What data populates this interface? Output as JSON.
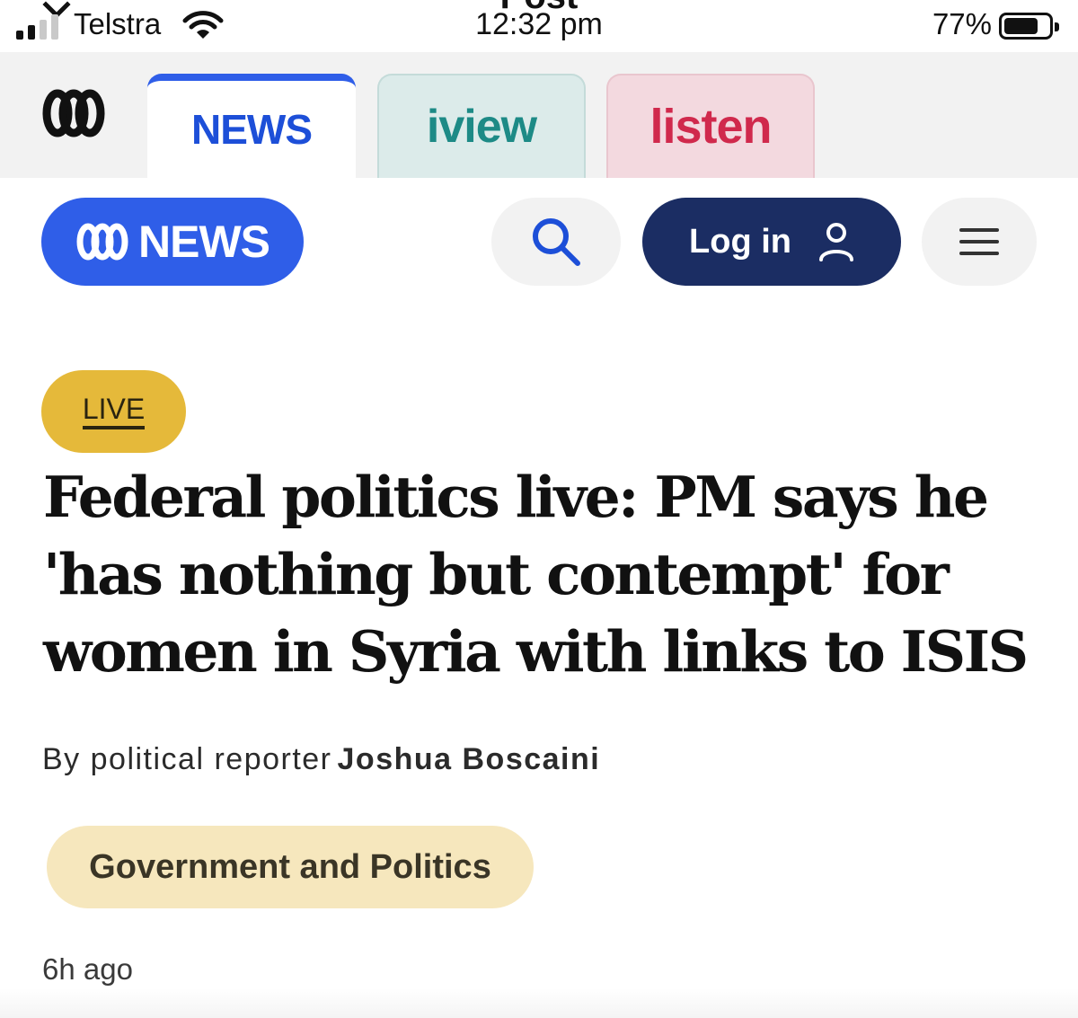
{
  "status_bar": {
    "carrier": "Telstra",
    "time": "12:32 pm",
    "partial_top_text": "Post",
    "battery_percent": "77%",
    "battery_level": 0.77,
    "signal_bars_active": 2,
    "signal_bars_total": 4
  },
  "product_tabs": [
    {
      "label": "NEWS",
      "selected": true
    },
    {
      "label": "iview",
      "selected": false
    },
    {
      "label": "listen",
      "selected": false
    }
  ],
  "header": {
    "brand_label": "NEWS",
    "login_label": "Log in"
  },
  "article": {
    "badge": "LIVE",
    "headline": "Federal politics live: PM says he 'has nothing but contempt' for women in Syria with links to ISIS",
    "byline_prefix": "By political reporter",
    "author": "Joshua Boscaini",
    "topic": "Government and Politics",
    "timestamp": "6h ago"
  },
  "colors": {
    "news_blue": "#2f5ee8",
    "login_navy": "#1b2d63",
    "live_yellow": "#e5b93a",
    "topic_cream": "#f6e7bd",
    "iview_teal": "#1d8a86",
    "listen_red": "#d0294c"
  },
  "icons": {
    "abc_logo": "abc-logo-icon",
    "search": "search-icon",
    "user": "user-icon",
    "menu": "hamburger-menu-icon",
    "wifi": "wifi-icon",
    "signal": "signal-icon",
    "battery": "battery-icon"
  }
}
